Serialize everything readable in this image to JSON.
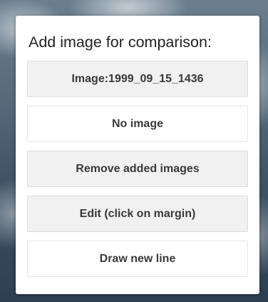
{
  "panel": {
    "title": "Add image for comparison:",
    "buttons": [
      {
        "label": "Image:1999_09_15_1436",
        "style": "grey"
      },
      {
        "label": "No image",
        "style": "white"
      },
      {
        "label": "Remove added images",
        "style": "grey"
      },
      {
        "label": "Edit (click on margin)",
        "style": "grey"
      },
      {
        "label": "Draw new line",
        "style": "white"
      }
    ]
  },
  "colors": {
    "panel_bg": "#ffffff",
    "button_grey": "#f1f1f1",
    "text": "#3a3a3a"
  }
}
